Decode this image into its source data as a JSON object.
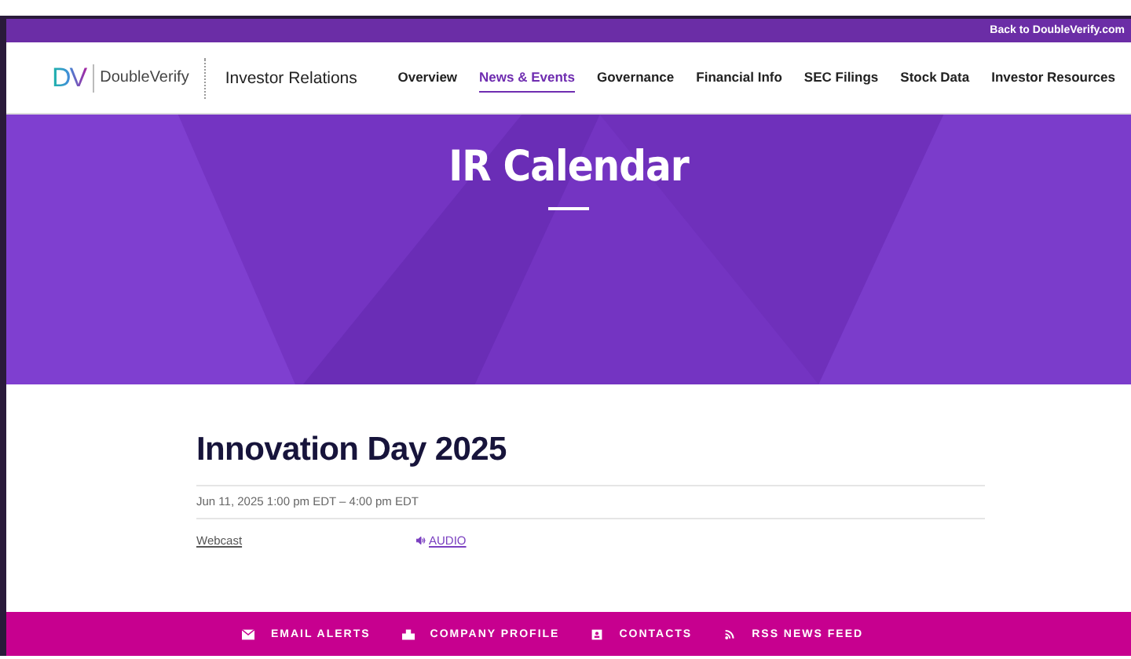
{
  "top_bar": {
    "link": "Back to DoubleVerify.com"
  },
  "header": {
    "logo_mark": "DV",
    "logo_text": "DoubleVerify",
    "site_title": "Investor Relations",
    "nav": [
      {
        "label": "Overview",
        "selected": false
      },
      {
        "label": "News & Events",
        "selected": true
      },
      {
        "label": "Governance",
        "selected": false
      },
      {
        "label": "Financial Info",
        "selected": false
      },
      {
        "label": "SEC Filings",
        "selected": false
      },
      {
        "label": "Stock Data",
        "selected": false
      },
      {
        "label": "Investor Resources",
        "selected": false
      }
    ]
  },
  "hero": {
    "title": "IR Calendar"
  },
  "event": {
    "title": "Innovation Day 2025",
    "date": "Jun 11, 2025 1:00 pm EDT – 4:00 pm EDT",
    "links": [
      {
        "kind": "webcast",
        "label": "Webcast"
      },
      {
        "kind": "audio",
        "label": "AUDIO"
      }
    ]
  },
  "footer": {
    "links": [
      {
        "kind": "email",
        "label": "EMAIL ALERTS"
      },
      {
        "kind": "company",
        "label": "COMPANY PROFILE"
      },
      {
        "kind": "contacts",
        "label": "CONTACTS"
      },
      {
        "kind": "rss",
        "label": "RSS NEWS FEED"
      }
    ]
  }
}
